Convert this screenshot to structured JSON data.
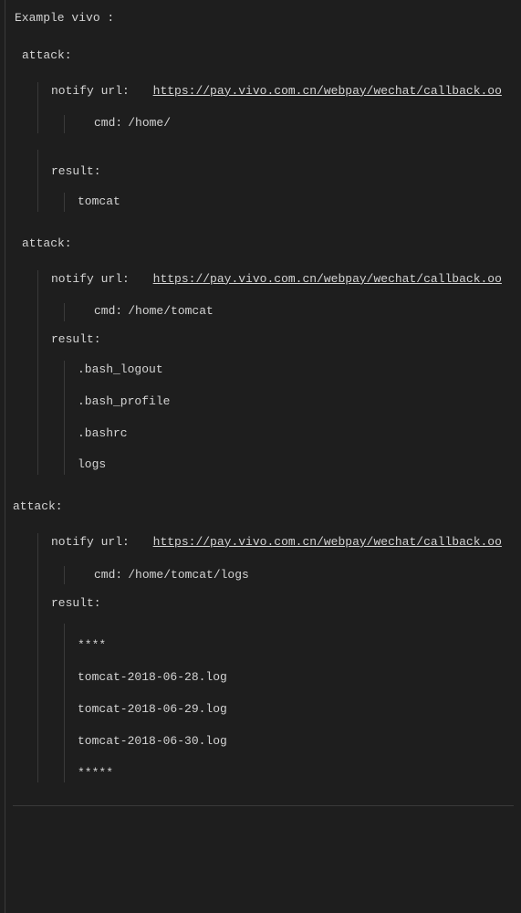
{
  "header": "Example  vivo :",
  "attacks": [
    {
      "label": "attack:",
      "notify_label": "notify url:",
      "notify_url": "https://pay.vivo.com.cn/webpay/wechat/callback.oo",
      "cmd_label": "cmd:",
      "cmd_value": "/home/",
      "result_label": "result:",
      "results": [
        "tomcat"
      ]
    },
    {
      "label": "attack:",
      "notify_label": "notify url:",
      "notify_url": "https://pay.vivo.com.cn/webpay/wechat/callback.oo",
      "cmd_label": "cmd:",
      "cmd_value": "/home/tomcat",
      "result_label": "result:",
      "results": [
        ".bash_logout",
        ".bash_profile",
        ".bashrc",
        "logs"
      ]
    },
    {
      "label": "attack:",
      "notify_label": "notify url:",
      "notify_url": "https://pay.vivo.com.cn/webpay/wechat/callback.oo",
      "cmd_label": "cmd:",
      "cmd_value": "/home/tomcat/logs",
      "result_label": "result:",
      "results": [
        "****",
        "tomcat-2018-06-28.log",
        "tomcat-2018-06-29.log",
        "tomcat-2018-06-30.log",
        "*****"
      ]
    }
  ]
}
